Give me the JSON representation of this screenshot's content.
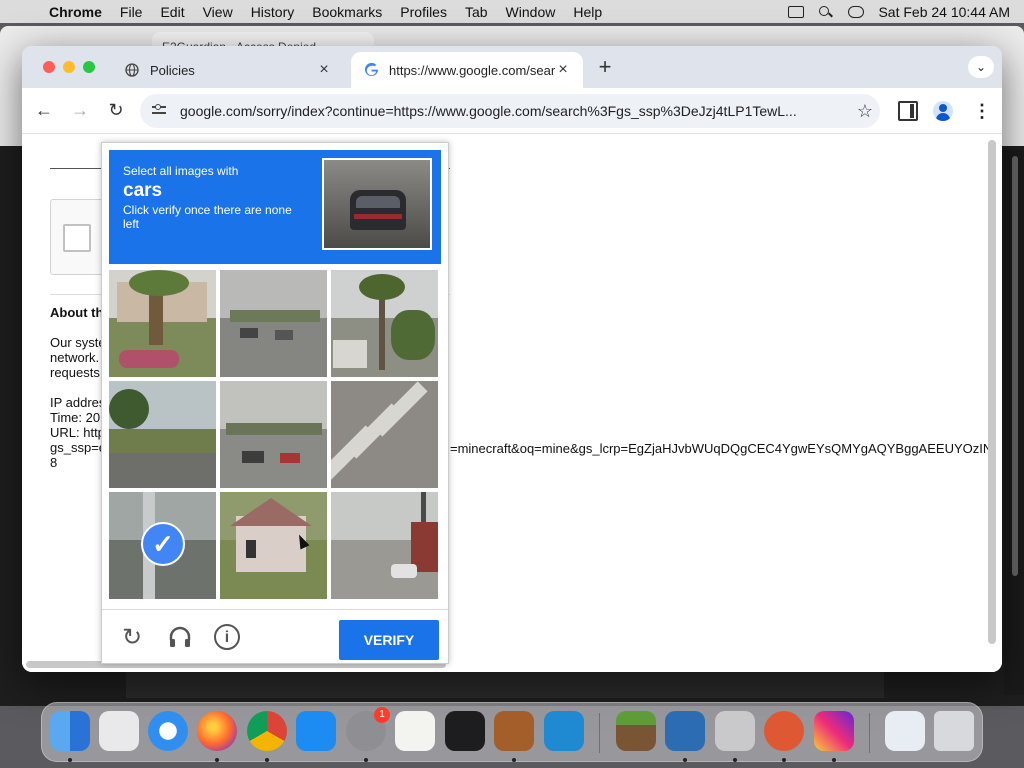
{
  "menubar": {
    "app": "Chrome",
    "items": [
      "File",
      "Edit",
      "View",
      "History",
      "Bookmarks",
      "Profiles",
      "Tab",
      "Window",
      "Help"
    ],
    "datetime": "Sat Feb 24  10:44 AM"
  },
  "background_window": {
    "tab_title": "E2Guardian - Access Denied"
  },
  "browser": {
    "tabs": [
      {
        "title": "Policies",
        "favicon": "globe-icon"
      },
      {
        "title": "https://www.google.com/sear",
        "favicon": "google-icon"
      }
    ],
    "newtab_label": "+",
    "url": "google.com/sorry/index?continue=https://www.google.com/search%3Fgs_ssp%3DeJzj4tLP1TewL..."
  },
  "page": {
    "about_heading": "About th",
    "para1_lines": [
      "Our syste",
      "network.",
      "requests"
    ],
    "para2_lines": [
      "IP addres",
      "Time: 20",
      "URL: http",
      "gs_ssp=e",
      "8"
    ],
    "url_tail": "=minecraft&oq=mine&gs_lcrp=EgZjaHJvbWUqDQgCEC4YgwEYsQMYgAQYBggAEEUYOzIN("
  },
  "captcha": {
    "instruction": "Select all images with",
    "target": "cars",
    "sub_instruction": "Click verify once there are none left",
    "tiles": [
      {
        "label": "palm trees and flowers roadside",
        "selected": false
      },
      {
        "label": "parking lot with cars",
        "selected": false
      },
      {
        "label": "palm tree and house",
        "selected": false
      },
      {
        "label": "grassy roadside",
        "selected": false
      },
      {
        "label": "parking lot with cars",
        "selected": false
      },
      {
        "label": "crosswalk",
        "selected": false
      },
      {
        "label": "street with pole",
        "selected": true
      },
      {
        "label": "house",
        "selected": false
      },
      {
        "label": "residential street with cars",
        "selected": false
      }
    ],
    "verify_label": "VERIFY",
    "icons": [
      "reload-icon",
      "headphones-icon",
      "info-icon"
    ]
  },
  "dock": {
    "apps": [
      "Finder",
      "Launchpad",
      "Safari",
      "Firefox",
      "Chrome",
      "App Store",
      "System Settings",
      "TextEdit",
      "Terminal",
      "Instruments",
      "VS Code",
      "Minecraft",
      "VirtualBox",
      "Disk Utility",
      "DuckDuckGo",
      "Instagram",
      "Downloads",
      "Trash"
    ],
    "settings_badge": "1"
  }
}
